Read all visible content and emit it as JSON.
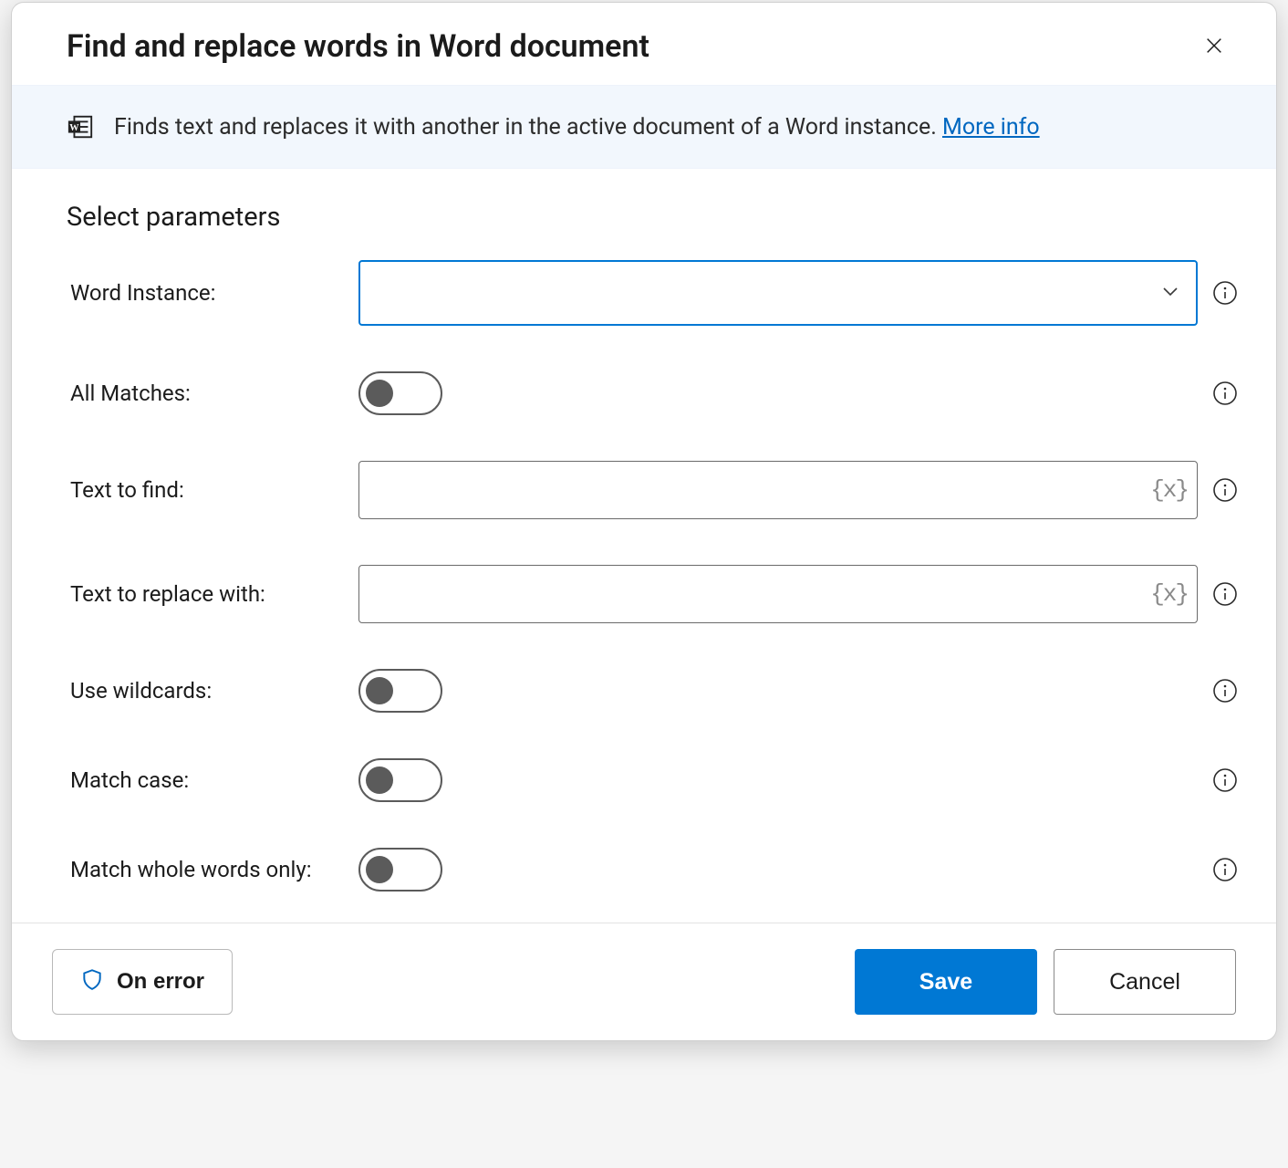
{
  "dialog": {
    "title": "Find and replace words in Word document",
    "info_text": "Finds text and replaces it with another in the active document of a Word instance. ",
    "more_info_label": "More info",
    "section_title": "Select parameters"
  },
  "fields": {
    "word_instance": {
      "label": "Word Instance:",
      "value": ""
    },
    "all_matches": {
      "label": "All Matches:",
      "value": false
    },
    "text_to_find": {
      "label": "Text to find:",
      "value": ""
    },
    "text_to_replace": {
      "label": "Text to replace with:",
      "value": ""
    },
    "use_wildcards": {
      "label": "Use wildcards:",
      "value": false
    },
    "match_case": {
      "label": "Match case:",
      "value": false
    },
    "match_whole": {
      "label": "Match whole words only:",
      "value": false
    }
  },
  "footer": {
    "on_error": "On error",
    "save": "Save",
    "cancel": "Cancel"
  },
  "icons": {
    "variable_glyph": "{x}"
  }
}
